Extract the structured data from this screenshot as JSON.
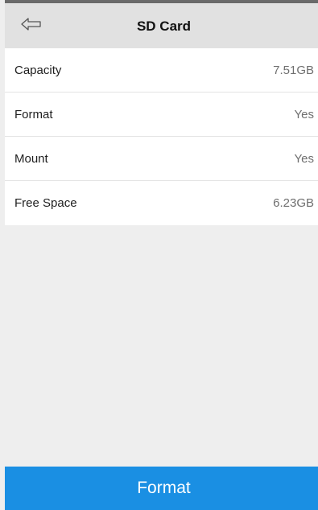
{
  "header": {
    "title": "SD Card",
    "back_icon": "back-arrow-icon"
  },
  "info_rows": [
    {
      "label": "Capacity",
      "value": "7.51GB"
    },
    {
      "label": "Format",
      "value": "Yes"
    },
    {
      "label": "Mount",
      "value": "Yes"
    },
    {
      "label": "Free Space",
      "value": "6.23GB"
    }
  ],
  "footer": {
    "format_label": "Format"
  },
  "colors": {
    "header_bg": "#e1e1e1",
    "accent": "#1a8fe3",
    "page_bg": "#eeeeee"
  }
}
